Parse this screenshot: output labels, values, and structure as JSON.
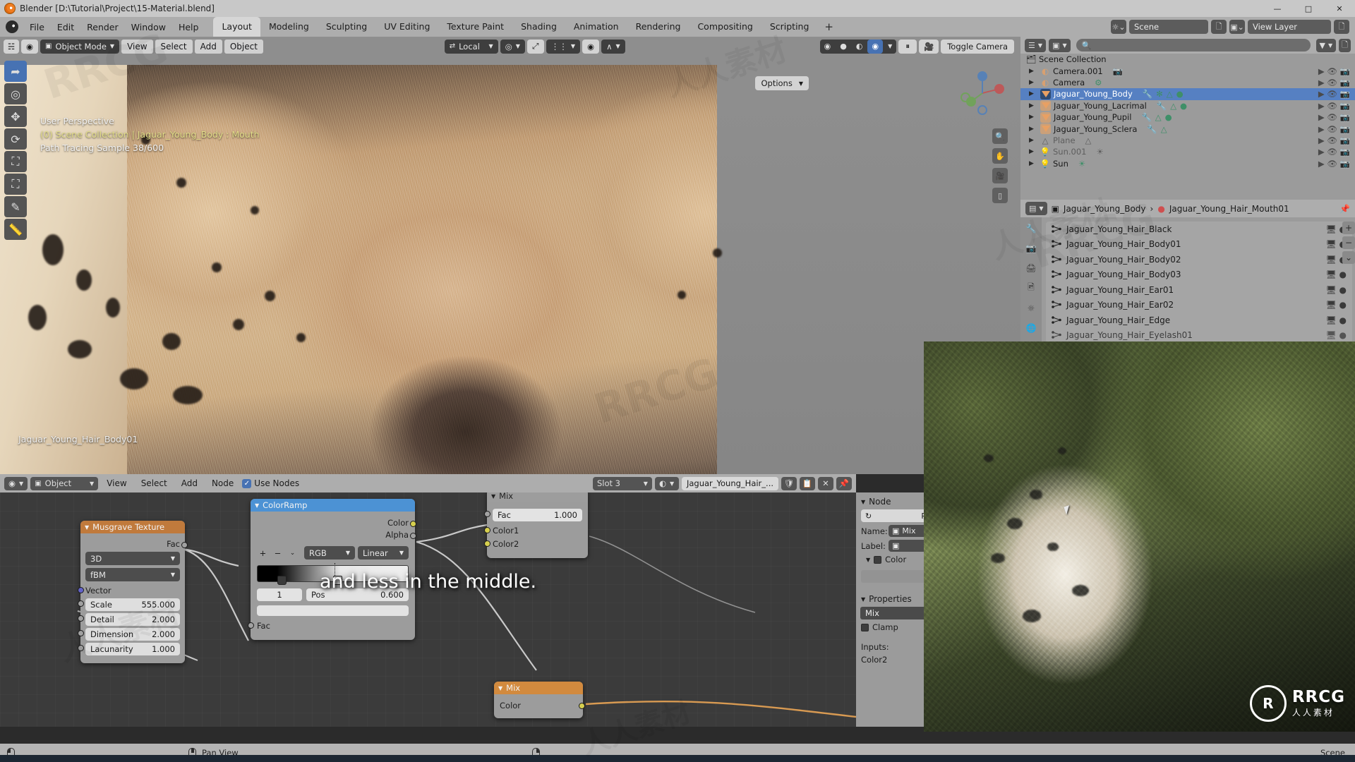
{
  "window": {
    "title": "Blender [D:\\Tutorial\\Project\\15-Material.blend]",
    "minimize": "—",
    "maximize": "□",
    "close": "✕"
  },
  "topbar": {
    "menus": [
      "File",
      "Edit",
      "Render",
      "Window",
      "Help"
    ],
    "workspaces": [
      "Layout",
      "Modeling",
      "Sculpting",
      "UV Editing",
      "Texture Paint",
      "Shading",
      "Animation",
      "Rendering",
      "Compositing",
      "Scripting"
    ],
    "add_workspace": "+",
    "scene_name": "Scene",
    "view_layer_name": "View Layer",
    "scene_icon": "scene-icon",
    "view_layer_icon": "view-layer-icon",
    "new_scene_icon": "new-scene-icon",
    "new_layer_icon": "new-layer-icon"
  },
  "viewport": {
    "editor_type_icon": "editor-type-3dview",
    "mode": "Object Mode",
    "menus": [
      "View",
      "Select",
      "Add",
      "Object"
    ],
    "transform_orientation": "Local",
    "snap_icon": "snap-magnet-icon",
    "proportional_icon": "proportional-edit-icon",
    "options_label": "Options",
    "toggle_camera_label": "Toggle Camera",
    "pause_icon": "pause-icon",
    "camera_icon": "camera-icon",
    "shading_modes": [
      "wireframe",
      "solid",
      "material-preview",
      "rendered"
    ],
    "active_shading": "rendered",
    "overlay": {
      "perspective": "User Perspective",
      "collection": "(0) Scene Collection | Jaguar_Young_Body : Mouth",
      "samples": "Path Tracing Sample 38/600"
    },
    "active_object_label": "Jaguar_Young_Hair_Body01",
    "tools": [
      "tweak-tool",
      "cursor-tool",
      "move-tool",
      "rotate-tool",
      "scale-tool",
      "transform-tool",
      "annotate-tool",
      "measure-tool"
    ]
  },
  "outliner": {
    "display_mode": "View Layer",
    "filter_icon": "filter-icon",
    "search_placeholder": "",
    "root": "Scene Collection",
    "items": [
      {
        "name": "Camera.001",
        "icon": "camera-object-icon",
        "selected": false,
        "dim": false,
        "badges": [
          "camera-data"
        ]
      },
      {
        "name": "Camera",
        "icon": "camera-object-icon",
        "selected": false,
        "dim": false,
        "badges": [
          "camera-data",
          "mesh-data"
        ]
      },
      {
        "name": "Jaguar_Young_Body",
        "icon": "mesh-object-icon",
        "selected": true,
        "dim": false,
        "badges": [
          "modifier",
          "particles",
          "mesh-data",
          "material"
        ]
      },
      {
        "name": "Jaguar_Young_Lacrimal",
        "icon": "mesh-object-icon",
        "selected": false,
        "dim": false,
        "badges": [
          "modifier",
          "mesh-data",
          "material"
        ]
      },
      {
        "name": "Jaguar_Young_Pupil",
        "icon": "mesh-object-icon",
        "selected": false,
        "dim": false,
        "badges": [
          "modifier",
          "mesh-data",
          "material"
        ]
      },
      {
        "name": "Jaguar_Young_Sclera",
        "icon": "mesh-object-icon",
        "selected": false,
        "dim": false,
        "badges": [
          "modifier",
          "mesh-data",
          "material"
        ]
      },
      {
        "name": "Plane",
        "icon": "mesh-object-icon",
        "selected": false,
        "dim": true,
        "badges": [
          "mesh-data"
        ]
      },
      {
        "name": "Sun.001",
        "icon": "light-object-icon",
        "selected": false,
        "dim": true,
        "badges": [
          "light-data"
        ]
      },
      {
        "name": "Sun",
        "icon": "light-object-icon",
        "selected": false,
        "dim": false,
        "badges": [
          "light-data"
        ]
      }
    ]
  },
  "properties": {
    "breadcrumb": [
      "Jaguar_Young_Body",
      "Jaguar_Young_Hair_Mouth01"
    ],
    "editor_icon": "properties-editor-icon",
    "object_icon": "object-data-icon",
    "tabs": [
      "tool-tab",
      "render-tab",
      "output-tab",
      "view-layer-tab",
      "scene-tab",
      "world-tab",
      "object-tab",
      "modifier-tab",
      "particle-tab",
      "physics-tab",
      "constraint-tab",
      "data-tab",
      "material-tab"
    ],
    "active_tab_index": 12,
    "material_slots": [
      "Jaguar_Young_Hair_Black",
      "Jaguar_Young_Hair_Body01",
      "Jaguar_Young_Hair_Body02",
      "Jaguar_Young_Hair_Body03",
      "Jaguar_Young_Hair_Ear01",
      "Jaguar_Young_Hair_Ear02",
      "Jaguar_Young_Hair_Edge",
      "Jaguar_Young_Hair_Eyelash01"
    ],
    "slot_add": "+",
    "slot_remove": "−",
    "slot_menu": "⌄"
  },
  "node_editor": {
    "editor_icon": "shader-editor-icon",
    "shader_type": "Object",
    "menus": [
      "View",
      "Select",
      "Add",
      "Node"
    ],
    "use_nodes_label": "Use Nodes",
    "use_nodes_checked": true,
    "slot_label": "Slot 3",
    "material_name": "Jaguar_Young_Hair_...",
    "shield_icon": "fake-user-icon",
    "copy_icon": "duplicate-icon",
    "close_icon": "unlink-icon",
    "pin_icon": "pin-icon",
    "nodes": [
      {
        "id": "musgrave",
        "title": "Musgrave Texture",
        "header_color": "#c07a3c",
        "outputs": [
          "Fac"
        ],
        "dropdowns": [
          "3D",
          "fBM"
        ],
        "input_label": "Vector",
        "values": [
          {
            "label": "Scale",
            "value": "555.000"
          },
          {
            "label": "Detail",
            "value": "2.000"
          },
          {
            "label": "Dimension",
            "value": "2.000"
          },
          {
            "label": "Lacunarity",
            "value": "1.000"
          }
        ]
      },
      {
        "id": "colorramp",
        "title": "ColorRamp",
        "header_color": "#4c92d4",
        "outputs": [
          "Color",
          "Alpha"
        ],
        "buttons": [
          "+",
          "−",
          "⌄"
        ],
        "color_mode": "RGB",
        "interpolation": "Linear",
        "index": "1",
        "pos_label": "Pos",
        "pos_value": "0.600",
        "input_label": "Fac"
      },
      {
        "id": "mix_top",
        "title": "Mix",
        "header_color": "#9d9d9d",
        "rows": [
          {
            "label": "Fac",
            "value": "1.000"
          },
          {
            "label": "Color1",
            "value": ""
          },
          {
            "label": "Color2",
            "value": ""
          }
        ]
      },
      {
        "id": "mix_bottom",
        "title": "Mix",
        "header_color": "#d28a3e",
        "rows": [
          {
            "label": "Color",
            "value": ""
          }
        ]
      }
    ]
  },
  "n_panel": {
    "node_section": "Node",
    "reset_label": "Res",
    "reset_icon": "refresh-icon",
    "name_label": "Name:",
    "name_value": "Mix",
    "label_label": "Label:",
    "label_value": "",
    "color_label": "Color",
    "properties_section": "Properties",
    "blend_mode": "Mix",
    "clamp_label": "Clamp",
    "inputs_label": "Inputs:",
    "input_name": "Color2"
  },
  "subtitle": {
    "text": "and less in the middle."
  },
  "statusbar": {
    "left_icon": "mouse-left-icon",
    "middle_icon": "mouse-middle-icon",
    "middle_action": "Pan View",
    "right_icon": "mouse-right-icon",
    "scene_label": "Scene"
  },
  "pip_overlay": {
    "brand_initials": "R",
    "brand_text": "RRCG",
    "brand_sub": "人人素材"
  },
  "watermarks": {
    "rrcg": "RRCG",
    "cn": "人人素材"
  },
  "colors": {
    "accent_blue": "#4772b3",
    "selection_blue": "#5680c2",
    "header_grey": "#adadad",
    "panel_grey": "#9b9b9b",
    "node_canvas": "#3b3b3b",
    "orange_node": "#c07a3c",
    "blue_node": "#4c92d4"
  }
}
